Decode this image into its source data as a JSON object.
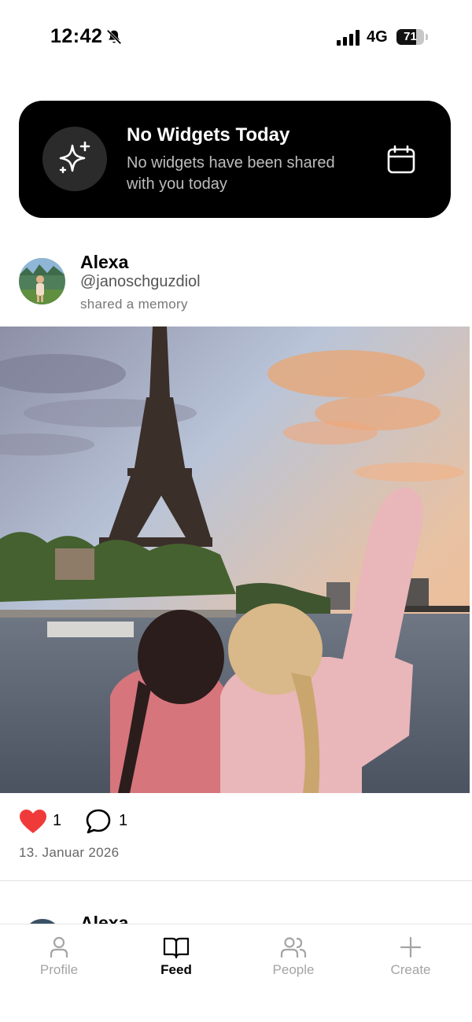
{
  "status_bar": {
    "time": "12:42",
    "network": "4G",
    "battery_percent": "71",
    "battery_level": 0.71
  },
  "widget_card": {
    "title": "No Widgets Today",
    "subtitle": "No widgets have been shared with you today",
    "icon": "sparkles-icon",
    "action_icon": "calendar-icon"
  },
  "post": {
    "user_name": "Alexa",
    "handle": "@janoschguzdiol",
    "action": "shared a memory",
    "image_description_icon": "memory-photo",
    "likes": "1",
    "comments": "1",
    "date": "13. Januar 2026",
    "like_color": "#f03a3a"
  },
  "next_post": {
    "user_name": "Alexa"
  },
  "tab_bar": {
    "tabs": [
      {
        "label": "Profile",
        "icon": "person-icon",
        "active": false
      },
      {
        "label": "Feed",
        "icon": "book-icon",
        "active": true
      },
      {
        "label": "People",
        "icon": "people-icon",
        "active": false
      },
      {
        "label": "Create",
        "icon": "plus-icon",
        "active": false
      }
    ]
  }
}
